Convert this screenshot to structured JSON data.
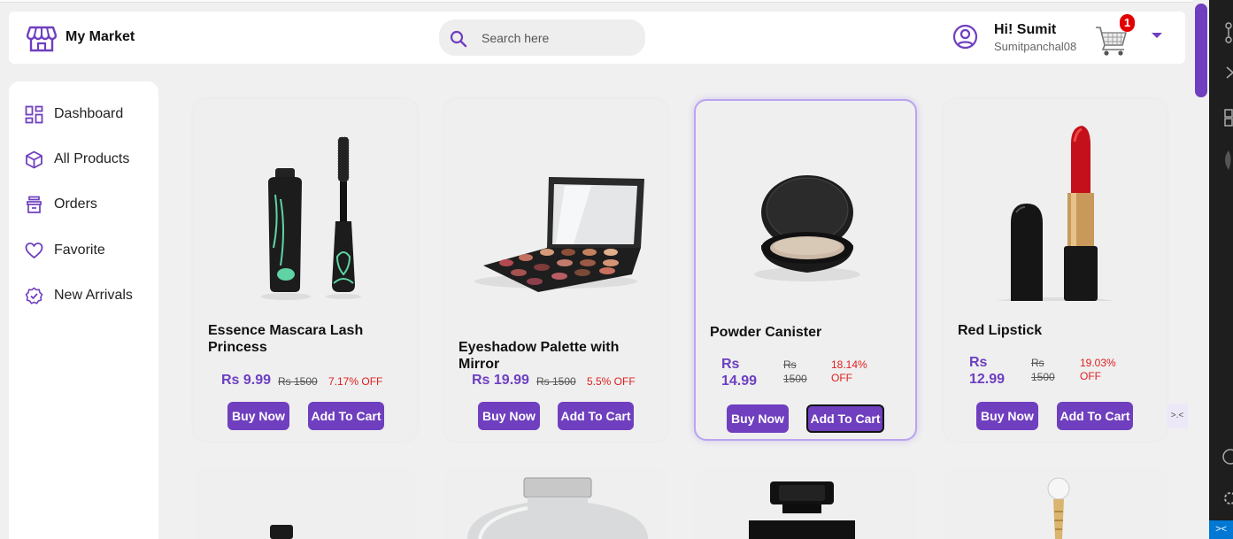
{
  "app": {
    "brand": "My Market"
  },
  "search": {
    "placeholder": "Search here"
  },
  "user": {
    "greeting": "Hi! Sumit",
    "username": "Sumitpanchal08"
  },
  "cart": {
    "count": "1"
  },
  "sidebar": {
    "items": [
      {
        "label": "Dashboard",
        "icon": "dashboard-icon"
      },
      {
        "label": "All Products",
        "icon": "box-icon"
      },
      {
        "label": "Orders",
        "icon": "orders-icon"
      },
      {
        "label": "Favorite",
        "icon": "heart-icon"
      },
      {
        "label": "New Arrivals",
        "icon": "badge-icon"
      }
    ]
  },
  "products": [
    {
      "title": "Essence Mascara Lash Princess",
      "price": "Rs 9.99",
      "old_price": "Rs 1500",
      "discount": "7.17% OFF",
      "image": "mascara"
    },
    {
      "title": "Eyeshadow Palette with Mirror",
      "price": "Rs 19.99",
      "old_price": "Rs 1500",
      "discount": "5.5% OFF",
      "image": "eyeshadow-palette"
    },
    {
      "title": "Powder Canister",
      "price": "Rs 14.99",
      "old_price": "Rs 1500",
      "discount": "18.14% OFF",
      "image": "powder-canister"
    },
    {
      "title": "Red Lipstick",
      "price": "Rs 12.99",
      "old_price": "Rs 1500",
      "discount": "19.03% OFF",
      "image": "red-lipstick"
    }
  ],
  "buttons": {
    "buy_now": "Buy Now",
    "add_to_cart": "Add To Cart"
  },
  "colors": {
    "accent": "#6f3fbf",
    "discount": "#e01e1e",
    "badge": "#e30000"
  }
}
